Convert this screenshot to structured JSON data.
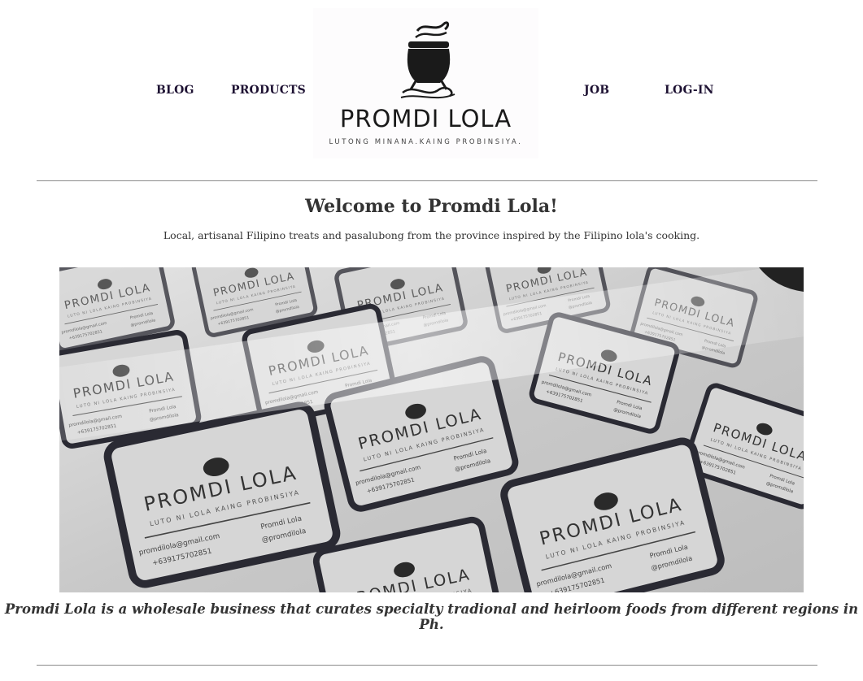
{
  "nav": {
    "blog": "BLOG",
    "products": "PRODUCTS",
    "job": "JOB",
    "login": "LOG-IN"
  },
  "logo": {
    "title": "PROMDI LOLA",
    "tagline": "LUTONG MINANA.KAING PROBINSIYA.",
    "icon": "cooking-pot-icon"
  },
  "main": {
    "welcome": "Welcome to Promdi Lola!",
    "subtitle": "Local, artisanal Filipino treats and pasalubong from the province inspired by the Filipino lola's cooking.",
    "caption": "Promdi Lola is a wholesale business that curates specialty tradional and heirloom foods from different regions in Ph."
  },
  "hero": {
    "label_title": "PROMDI LOLA",
    "label_tagline": "LUTO NI LOLA KAING PROBINSIYA",
    "label_email": "promdilola@gmail.com",
    "label_phone": "+639175702851",
    "label_facebook": "Promdi Lola",
    "label_instagram": "@promdilola"
  },
  "colors": {
    "nav_text": "#1e1233",
    "body_text": "#333333",
    "rule": "#8a8a8a"
  }
}
